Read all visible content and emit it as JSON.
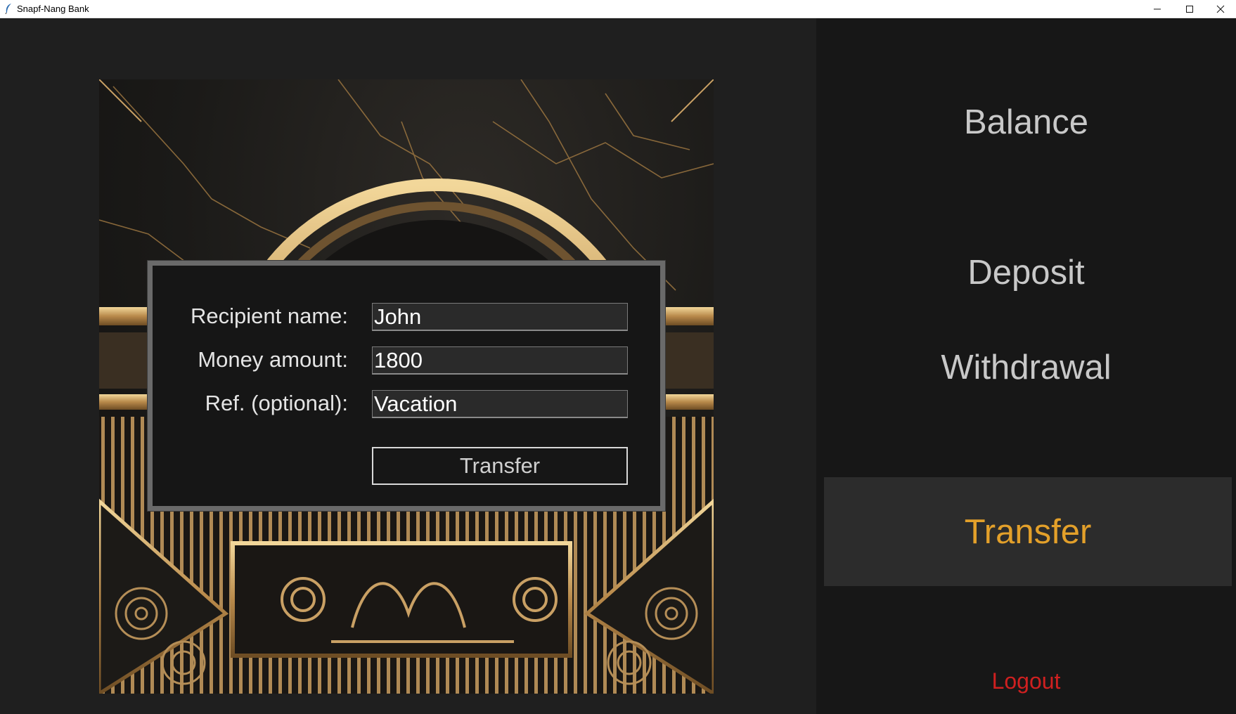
{
  "window": {
    "title": "Snapf-Nang Bank",
    "minimize_icon": "minimize-icon",
    "maximize_icon": "maximize-icon",
    "close_icon": "close-icon"
  },
  "colors": {
    "accent_active": "#e3a02a",
    "logout": "#cf2020",
    "menu_text": "#c8c8c8",
    "panel_bg": "#1f1f1f",
    "menu_bg": "#171717"
  },
  "form": {
    "recipient_label": "Recipient name:",
    "recipient_value": "John",
    "amount_label": "Money amount:",
    "amount_value": "1800",
    "reference_label": "Ref. (optional):",
    "reference_value": "Vacation",
    "submit_label": "Transfer"
  },
  "menu": {
    "balance": "Balance",
    "deposit": "Deposit",
    "withdrawal": "Withdrawal",
    "transfer": "Transfer",
    "logout": "Logout"
  }
}
